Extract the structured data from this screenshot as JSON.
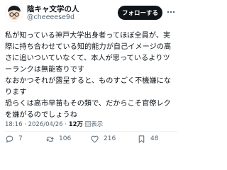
{
  "post": {
    "display_name": "陰キャ文学の人",
    "handle": "@cheeeese9d",
    "follow_label": "フォローする",
    "body_lines": [
      "私が知っている神戸大学出身者ってほぼ全員が、実",
      "際に持ち合わせている知的能力が自己イメージの高",
      "さに追いついていなくて、本人が思っているよりツ",
      "ーランクは無能寄りです",
      "なおかつそれが露呈すると、ものすごく不機嫌にな",
      "ります",
      "恐らくは高市早苗もその類で、だからこそ官僚レク",
      "を嫌がるのでしょうね"
    ],
    "time": "18:16",
    "date": "2026/04/26",
    "views_count": "12万",
    "views_label": "回表示"
  },
  "actions": {
    "replies": "7",
    "reposts": "106",
    "likes": "216",
    "bookmarks": "48"
  },
  "icons": {
    "avatar": "cartoon-face-avatar",
    "more": "more-options-icon",
    "reply": "reply-icon",
    "repost": "repost-icon",
    "like": "heart-icon",
    "bookmark": "bookmark-icon"
  }
}
